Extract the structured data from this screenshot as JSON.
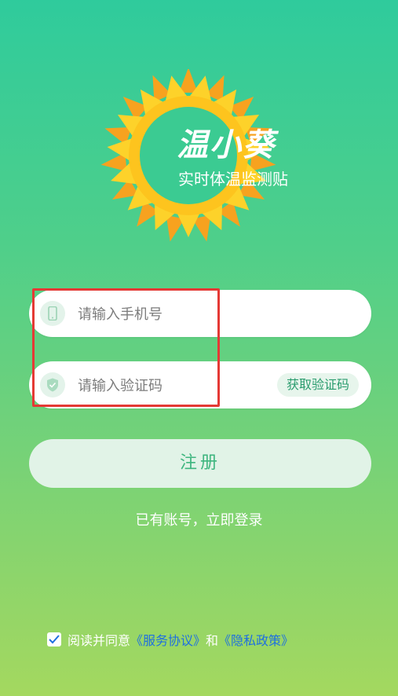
{
  "logo": {
    "title": "温小葵",
    "subtitle": "实时体温监测贴",
    "icon": "sunflower-logo"
  },
  "form": {
    "phone_placeholder": "请输入手机号",
    "code_placeholder": "请输入验证码",
    "get_code_label": "获取验证码",
    "phone_icon": "phone-icon",
    "code_icon": "shield-check-icon"
  },
  "register_label": "注册",
  "login_link": "已有账号，立即登录",
  "agreement": {
    "checked": true,
    "prefix": "阅读并同意",
    "service_terms": "《服务协议》",
    "and": "和",
    "privacy_policy": "《隐私政策》"
  },
  "colors": {
    "accent": "#3fb67f",
    "link": "#1e6fe0",
    "highlight_border": "#e53935"
  }
}
